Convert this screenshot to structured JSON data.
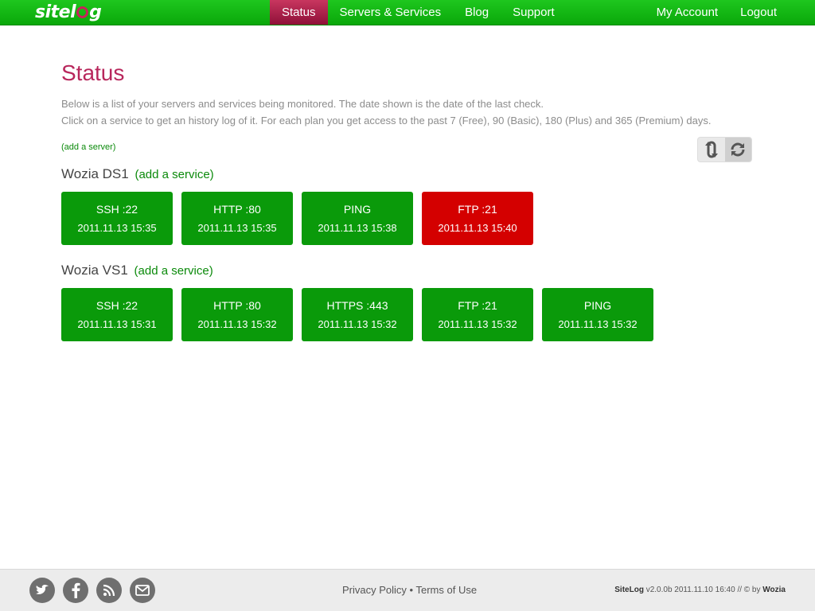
{
  "header": {
    "logo_text_before": "sitel",
    "logo_text_after": "g",
    "nav_left": [
      "Status",
      "Servers & Services",
      "Blog",
      "Support"
    ],
    "active": "Status",
    "nav_right": [
      "My Account",
      "Logout"
    ]
  },
  "page": {
    "title": "Status",
    "intro_line1": "Below is a list of your servers and services being monitored. The date shown is the date of the last check.",
    "intro_line2": "Click on a service to get an history log of it. For each plan you get access to the past 7 (Free), 90 (Basic), 180 (Plus) and 365 (Premium) days.",
    "add_server": "(add a server)"
  },
  "servers": [
    {
      "name": "Wozia DS1",
      "add_service": "(add a service)",
      "services": [
        {
          "label": "SSH :22",
          "time": "2011.11.13 15:35",
          "status": "up"
        },
        {
          "label": "HTTP :80",
          "time": "2011.11.13 15:35",
          "status": "up"
        },
        {
          "label": "PING",
          "time": "2011.11.13 15:38",
          "status": "up"
        },
        {
          "label": "FTP :21",
          "time": "2011.11.13 15:40",
          "status": "down"
        }
      ]
    },
    {
      "name": "Wozia VS1",
      "add_service": "(add a service)",
      "services": [
        {
          "label": "SSH :22",
          "time": "2011.11.13 15:31",
          "status": "up"
        },
        {
          "label": "HTTP :80",
          "time": "2011.11.13 15:32",
          "status": "up"
        },
        {
          "label": "HTTPS :443",
          "time": "2011.11.13 15:32",
          "status": "up"
        },
        {
          "label": "FTP :21",
          "time": "2011.11.13 15:32",
          "status": "up"
        },
        {
          "label": "PING",
          "time": "2011.11.13 15:32",
          "status": "up"
        }
      ]
    }
  ],
  "footer": {
    "social_icons": [
      "twitter-icon",
      "facebook-icon",
      "rss-icon",
      "mail-icon"
    ],
    "privacy": "Privacy Policy",
    "separator": "•",
    "terms": "Terms of Use",
    "brand": "SiteLog",
    "version_text": "v2.0.0b 2011.11.10 16:40 // © by",
    "company": "Wozia"
  },
  "colors": {
    "nav_green": "#0aa80a",
    "active_tab": "#b8275c",
    "tile_up": "#0a9a0a",
    "tile_down": "#d40000"
  }
}
